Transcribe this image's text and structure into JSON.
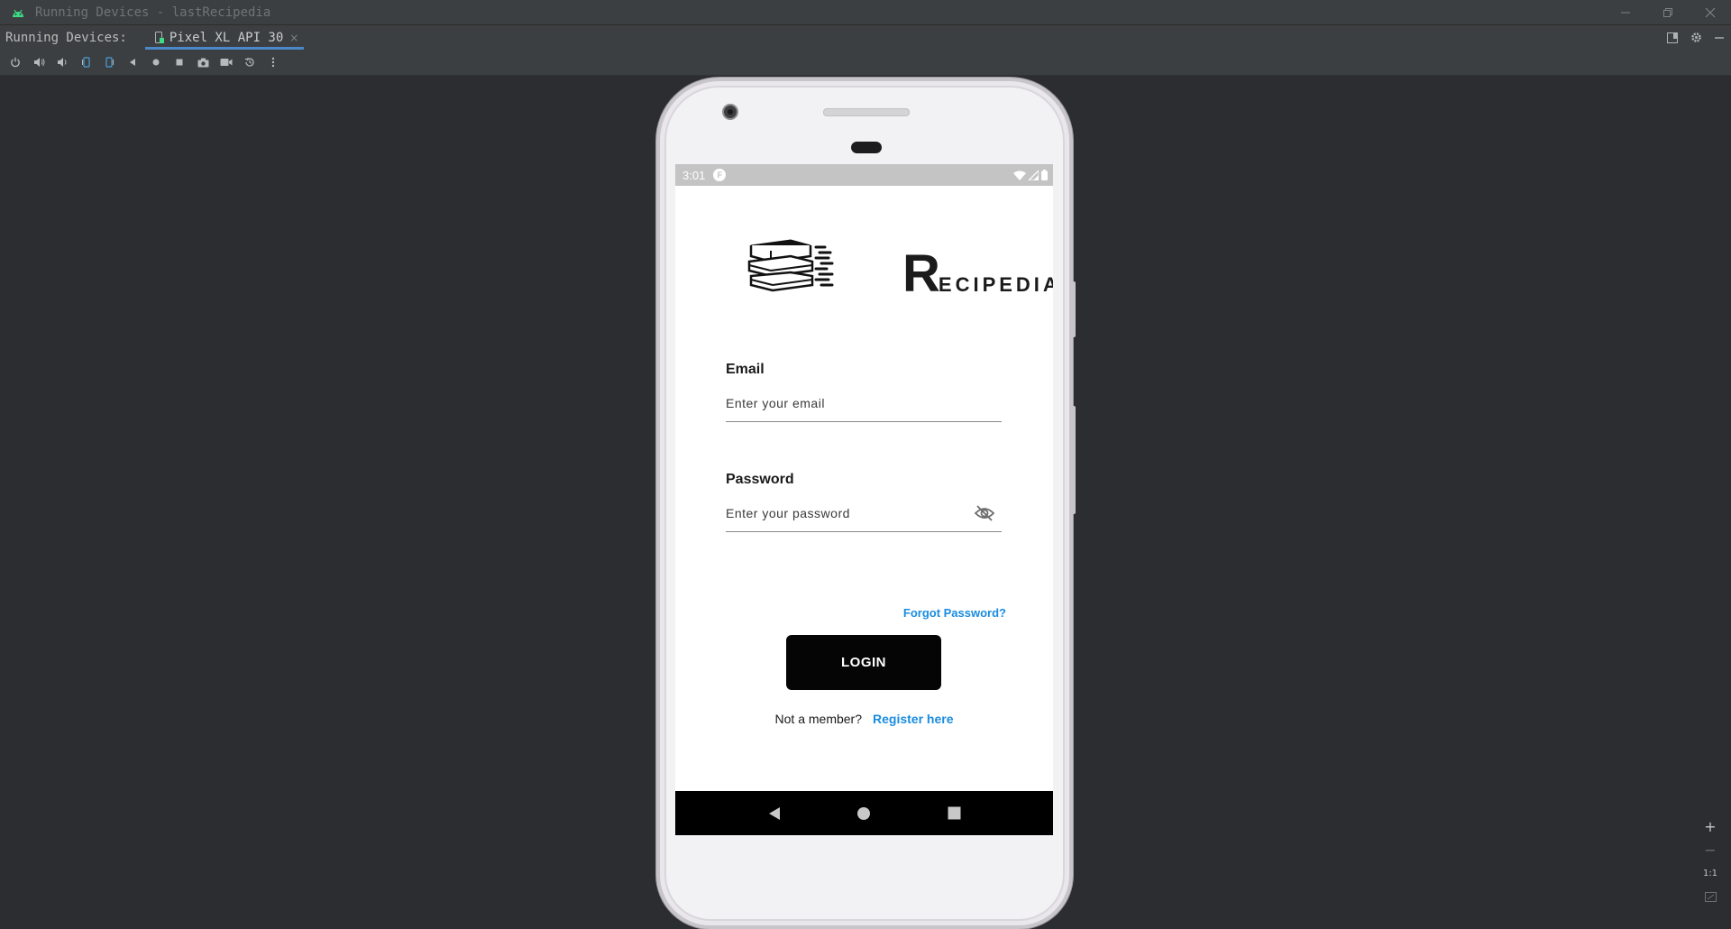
{
  "window": {
    "title": "Running Devices - lastRecipedia",
    "controls": [
      "minimize",
      "restore",
      "close"
    ]
  },
  "tabbar": {
    "label": "Running Devices:",
    "device_tab": "Pixel XL API 30"
  },
  "toolbar": {
    "icons": [
      "power-icon",
      "volume-up-icon",
      "volume-down-icon",
      "rotate-left-icon",
      "rotate-right-icon",
      "back-icon",
      "home-icon",
      "overview-icon",
      "screenshot-icon",
      "screen-record-icon",
      "snapshot-icon",
      "more-icon"
    ]
  },
  "status_bar": {
    "time": "3:01",
    "notification": "F"
  },
  "logo": {
    "big_letter": "R",
    "rest": "ECIPEDIA"
  },
  "form": {
    "email_label": "Email",
    "email_placeholder": "Enter your email",
    "email_value": "",
    "password_label": "Password",
    "password_placeholder": "Enter your password",
    "password_value": "",
    "forgot": "Forgot Password?",
    "login": "LOGIN",
    "not_member": "Not a member?",
    "register": "Register here"
  },
  "zoom": {
    "plus": "+",
    "minus": "−",
    "actual": "1:1"
  },
  "colors": {
    "link": "#1a8ce0",
    "button": "#050505",
    "ide_bg": "#2b2d30",
    "status_bar": "#c4c4c4"
  }
}
